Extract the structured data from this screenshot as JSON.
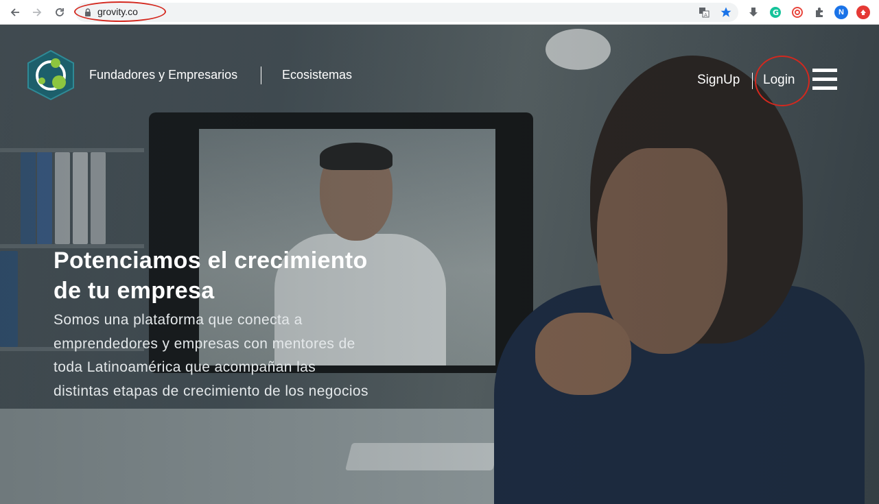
{
  "browser": {
    "url": "grovity.co",
    "avatar_letter": "N",
    "icons": [
      "back-icon",
      "forward-icon",
      "reload-icon",
      "lock-icon",
      "translate-icon",
      "bookmark-star-icon",
      "download-icon",
      "grammarly-icon",
      "extension-spiral-icon",
      "extensions-puzzle-icon",
      "profile-avatar",
      "update-icon"
    ],
    "annotation_color": "#d4281e"
  },
  "site": {
    "nav": {
      "founders_label": "Fundadores y Empresarios",
      "ecosystems_label": "Ecosistemas"
    },
    "auth": {
      "signup_label": "SignUp",
      "login_label": "Login"
    },
    "hero": {
      "headline_line1": "Potenciamos el crecimiento",
      "headline_line2": "de tu empresa",
      "sub_line1": "Somos una plataforma que conecta a",
      "sub_line2": "emprendedores y empresas con mentores de",
      "sub_line3": "toda Latinoamérica que acompañan las",
      "sub_line4": "distintas etapas de crecimiento de los negocios"
    },
    "colors": {
      "logo_teal": "#1d5f6b",
      "logo_green": "#8dc63f",
      "text": "#ffffff"
    }
  }
}
